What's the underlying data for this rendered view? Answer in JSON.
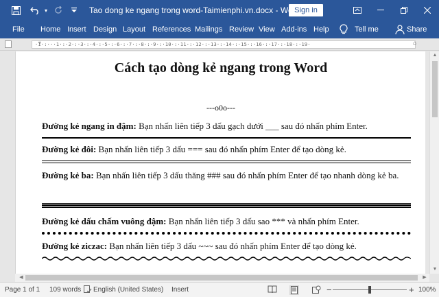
{
  "window": {
    "title": "Tao dong ke ngang trong word-Taimienphi.vn.docx  -  Word",
    "sign_in": "Sign in"
  },
  "ribbon": {
    "tabs": [
      "File",
      "Home",
      "Insert",
      "Design",
      "Layout",
      "References",
      "Mailings",
      "Review",
      "View",
      "Add-ins",
      "Help"
    ],
    "tell_me": "Tell me",
    "share": "Share"
  },
  "document": {
    "title": "Cách tạo dòng kẻ ngang trong Word",
    "separator": "---o0o---",
    "items": [
      {
        "label": "Đường kẻ ngang in đậm:",
        "text": " Bạn nhấn liên tiếp 3 dấu gạch dưới ___ sau đó nhấn phím Enter."
      },
      {
        "label": "Đường kẻ đôi:",
        "text": " Bạn nhấn liên tiếp 3 dấu === sau đó nhấn phím Enter để tạo dòng kẻ."
      },
      {
        "label": "Đường kẻ ba:",
        "text": " Bạn nhấn liên tiếp 3 dấu thăng ### sau đó nhấn phím Enter để tạo  nhanh dòng kẻ ba."
      },
      {
        "label": "Đường kẻ dấu chấm vuông đậm:",
        "text": " Bạn nhấn liên tiếp 3 dấu sao *** và nhấn phím Enter."
      },
      {
        "label": "Đường kẻ ziczac:",
        "text": " Bạn nhấn liên tiếp 3 dấu ~~~ sau đó nhấn phím Enter để tạo dòng kẻ."
      }
    ]
  },
  "status": {
    "page": "Page 1 of 1",
    "words": "109 words",
    "language": "English (United States)",
    "mode": "Insert",
    "zoom": "100%",
    "zoom_minus": "−",
    "zoom_plus": "+"
  },
  "colors": {
    "title_bar": "#2b579a",
    "ribbon_text": "#ffffff",
    "status_bar": "#f3f3f3"
  }
}
